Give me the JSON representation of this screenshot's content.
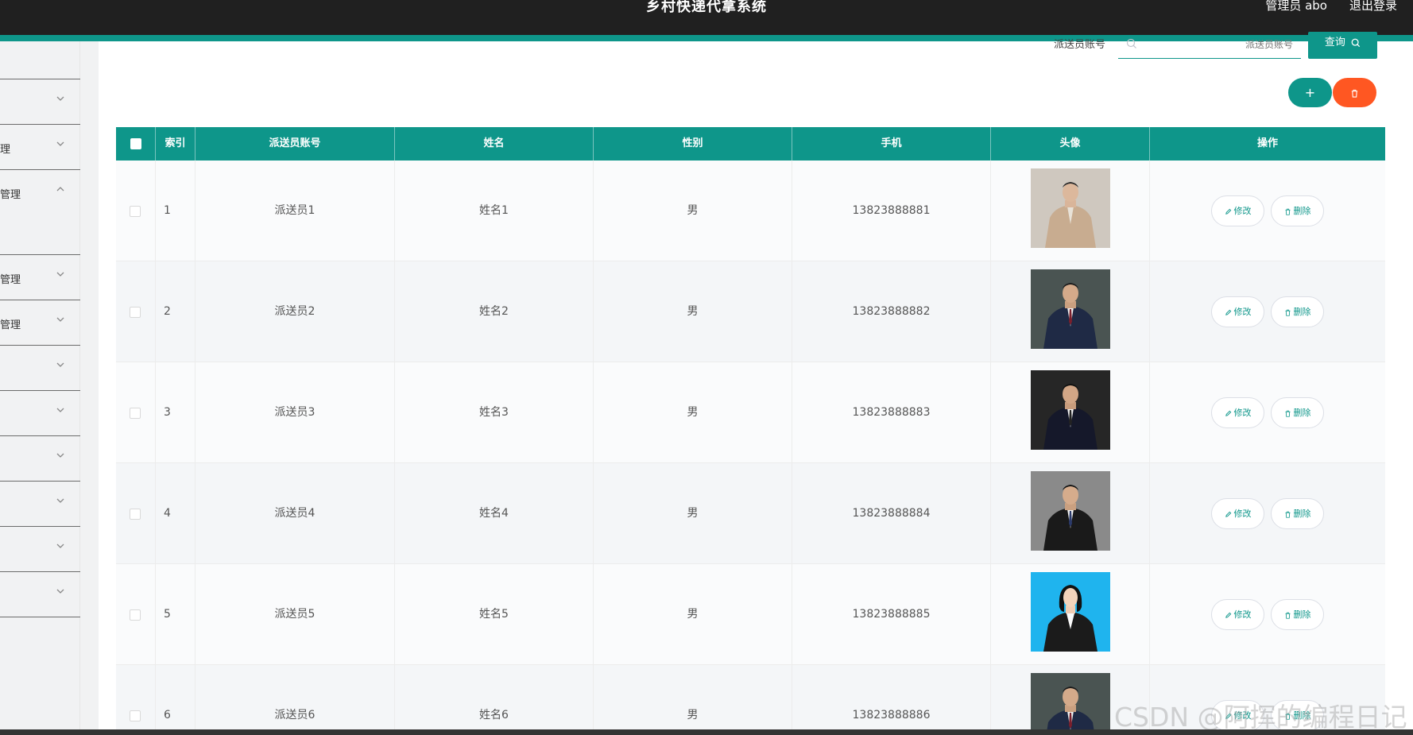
{
  "header": {
    "title": "乡村快递代拿系统",
    "user_label": "管理员 abo",
    "logout_label": "退出登录"
  },
  "sidebar": {
    "items": [
      {
        "label": ""
      },
      {
        "label": ""
      },
      {
        "label": "理"
      },
      {
        "label": "管理"
      },
      {
        "label": "管理"
      },
      {
        "label": "管理"
      },
      {
        "label": ""
      },
      {
        "label": ""
      },
      {
        "label": ""
      },
      {
        "label": ""
      },
      {
        "label": ""
      }
    ]
  },
  "search": {
    "label": "派送员账号",
    "placeholder": "派送员账号",
    "button_label": "查询"
  },
  "toolbar": {
    "add_label": "+"
  },
  "table": {
    "headers": [
      "索引",
      "派送员账号",
      "姓名",
      "性别",
      "手机",
      "头像",
      "操作"
    ],
    "edit_label": "修改",
    "delete_label": "删除",
    "rows": [
      {
        "index": "1",
        "account": "派送员1",
        "name": "姓名1",
        "gender": "男",
        "phone": "13823888881"
      },
      {
        "index": "2",
        "account": "派送员2",
        "name": "姓名2",
        "gender": "男",
        "phone": "13823888882"
      },
      {
        "index": "3",
        "account": "派送员3",
        "name": "姓名3",
        "gender": "男",
        "phone": "13823888883"
      },
      {
        "index": "4",
        "account": "派送员4",
        "name": "姓名4",
        "gender": "男",
        "phone": "13823888884"
      },
      {
        "index": "5",
        "account": "派送员5",
        "name": "姓名5",
        "gender": "男",
        "phone": "13823888885"
      },
      {
        "index": "6",
        "account": "派送员6",
        "name": "姓名6",
        "gender": "男",
        "phone": "13823888886"
      }
    ]
  },
  "watermark": "CSDN @阿挥的编程日记",
  "colors": {
    "accent": "#0e968a",
    "danger": "#ff5722",
    "header_bg": "#202020"
  }
}
